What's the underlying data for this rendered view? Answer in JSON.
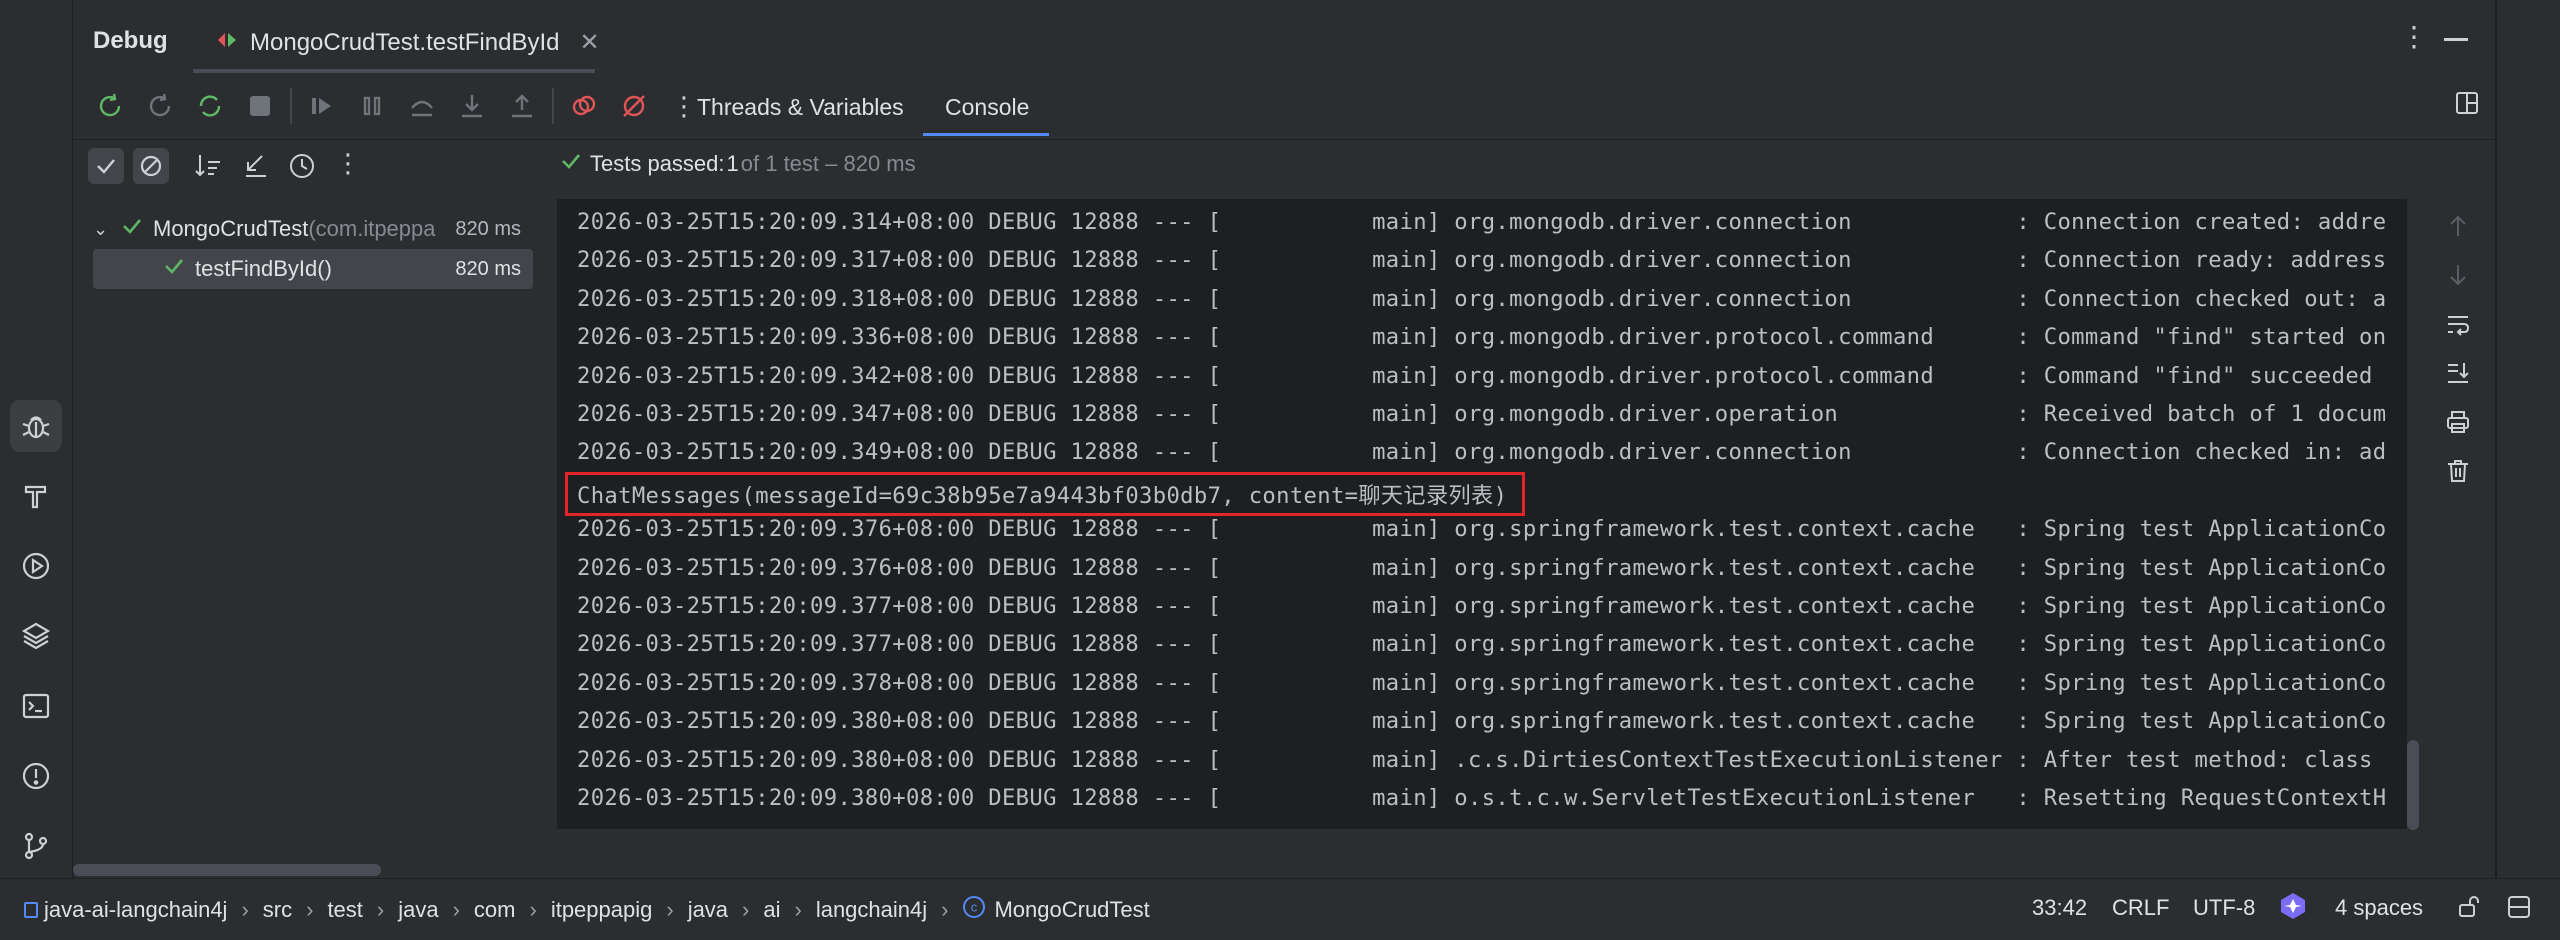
{
  "header": {
    "title": "Debug",
    "tab_label": "MongoCrudTest.testFindById"
  },
  "toolbar": {
    "tabs": [
      {
        "label": "Threads & Variables"
      },
      {
        "label": "Console"
      }
    ]
  },
  "test_status": {
    "prefix": "Tests passed: ",
    "count": "1",
    "suffix": " of 1 test – 820 ms"
  },
  "test_tree": {
    "root": {
      "name": "MongoCrudTest",
      "package": " (com.itpeppa",
      "time": "820 ms"
    },
    "child": {
      "name": "testFindById()",
      "time": "820 ms"
    }
  },
  "console": {
    "lines": [
      {
        "text": "2026-03-25T15:20:09.314+08:00 DEBUG 12888 --- [           main] org.mongodb.driver.connection            : Connection created: addre"
      },
      {
        "text": "2026-03-25T15:20:09.317+08:00 DEBUG 12888 --- [           main] org.mongodb.driver.connection            : Connection ready: address"
      },
      {
        "text": "2026-03-25T15:20:09.318+08:00 DEBUG 12888 --- [           main] org.mongodb.driver.connection            : Connection checked out: a"
      },
      {
        "text": "2026-03-25T15:20:09.336+08:00 DEBUG 12888 --- [           main] org.mongodb.driver.protocol.command      : Command \"find\" started on"
      },
      {
        "text": "2026-03-25T15:20:09.342+08:00 DEBUG 12888 --- [           main] org.mongodb.driver.protocol.command      : Command \"find\" succeeded"
      },
      {
        "text": "2026-03-25T15:20:09.347+08:00 DEBUG 12888 --- [           main] org.mongodb.driver.operation             : Received batch of 1 docum"
      },
      {
        "text": "2026-03-25T15:20:09.349+08:00 DEBUG 12888 --- [           main] org.mongodb.driver.connection            : Connection checked in: ad"
      },
      {
        "text": "ChatMessages(messageId=69c38b95e7a9443bf03b0db7, content=聊天记录列表)"
      },
      {
        "text": "2026-03-25T15:20:09.376+08:00 DEBUG 12888 --- [           main] org.springframework.test.context.cache   : Spring test ApplicationCo"
      },
      {
        "text": "2026-03-25T15:20:09.376+08:00 DEBUG 12888 --- [           main] org.springframework.test.context.cache   : Spring test ApplicationCo"
      },
      {
        "text": "2026-03-25T15:20:09.377+08:00 DEBUG 12888 --- [           main] org.springframework.test.context.cache   : Spring test ApplicationCo"
      },
      {
        "text": "2026-03-25T15:20:09.377+08:00 DEBUG 12888 --- [           main] org.springframework.test.context.cache   : Spring test ApplicationCo"
      },
      {
        "text": "2026-03-25T15:20:09.378+08:00 DEBUG 12888 --- [           main] org.springframework.test.context.cache   : Spring test ApplicationCo"
      },
      {
        "text": "2026-03-25T15:20:09.380+08:00 DEBUG 12888 --- [           main] org.springframework.test.context.cache   : Spring test ApplicationCo"
      },
      {
        "text": "2026-03-25T15:20:09.380+08:00 DEBUG 12888 --- [           main] .c.s.DirtiesContextTestExecutionListener : After test method: class"
      },
      {
        "text": "2026-03-25T15:20:09.380+08:00 DEBUG 12888 --- [           main] o.s.t.c.w.ServletTestExecutionListener   : Resetting RequestContextH"
      }
    ]
  },
  "breadcrumb": {
    "items": [
      "java-ai-langchain4j",
      "src",
      "test",
      "java",
      "com",
      "itpeppapig",
      "java",
      "ai",
      "langchain4j",
      "MongoCrudTest"
    ]
  },
  "status": {
    "position": "33:42",
    "line_sep": "CRLF",
    "encoding": "UTF-8",
    "indent": "4 spaces"
  },
  "colors": {
    "accent_green": "#5fb865",
    "highlight_red": "#e5242a",
    "panel_bg": "#2b2d30",
    "console_bg": "#1e1f22"
  }
}
